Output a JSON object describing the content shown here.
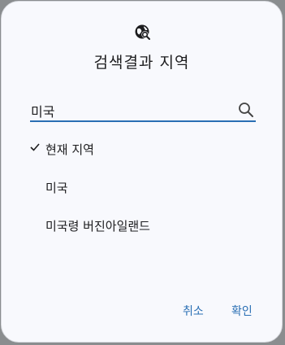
{
  "dialog": {
    "icon": "globe-search-icon",
    "title": "검색결과 지역"
  },
  "search": {
    "value": "미국",
    "icon": "search-icon"
  },
  "options": [
    {
      "label": "현재 지역",
      "selected": true
    },
    {
      "label": "미국",
      "selected": false
    },
    {
      "label": "미국령 버진아일랜드",
      "selected": false
    }
  ],
  "actions": {
    "cancel_label": "취소",
    "confirm_label": "확인"
  },
  "colors": {
    "accent": "#2a6fb4",
    "background": "#f8f9fd",
    "text": "#1d1d1f"
  }
}
